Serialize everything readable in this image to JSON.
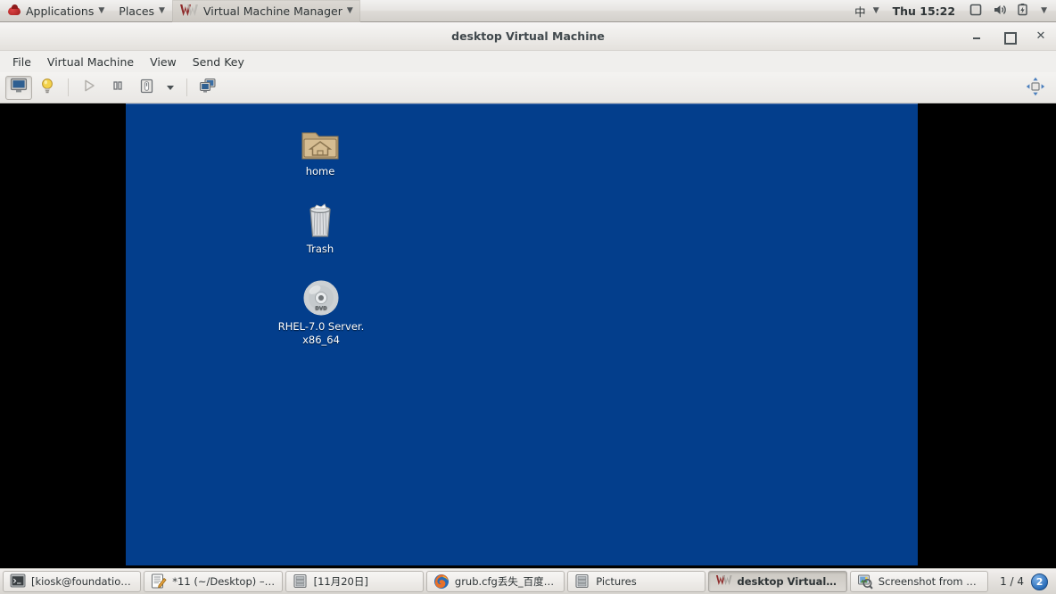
{
  "top_panel": {
    "applications_label": "Applications",
    "places_label": "Places",
    "active_window_label": "Virtual Machine Manager",
    "ime_label": "中",
    "clock": "Thu 15:22",
    "icons": {
      "menu_logo": "redhat-logo-icon",
      "app_icon": "virtual-machine-manager-icon",
      "screen_icon": "display-icon",
      "volume_icon": "volume-icon",
      "battery_icon": "battery-icon",
      "system_caret": "chevron-down-icon"
    }
  },
  "window": {
    "title": "desktop Virtual Machine",
    "controls": {
      "minimize": "–",
      "maximize": "□",
      "close": "✕"
    },
    "menu": [
      {
        "label": "File"
      },
      {
        "label": "Virtual Machine"
      },
      {
        "label": "View"
      },
      {
        "label": "Send Key"
      }
    ],
    "toolbar": [
      {
        "name": "show-console-button",
        "icon": "monitor-icon",
        "state": "pressed"
      },
      {
        "name": "show-details-button",
        "icon": "lightbulb-icon",
        "state": "normal"
      },
      {
        "name": "run-button",
        "icon": "play-icon",
        "state": "disabled"
      },
      {
        "name": "pause-button",
        "icon": "pause-icon",
        "state": "normal"
      },
      {
        "name": "shutdown-button",
        "icon": "power-switch-icon",
        "state": "normal"
      },
      {
        "name": "shutdown-menu-button",
        "icon": "chevron-down-icon",
        "state": "normal"
      },
      {
        "name": "snapshots-button",
        "icon": "clone-screens-icon",
        "state": "normal"
      },
      {
        "name": "fullscreen-button",
        "icon": "fullscreen-arrows-icon",
        "state": "normal"
      }
    ]
  },
  "vm_desktop": {
    "background_color": "#033e8c",
    "icons": [
      {
        "name": "home",
        "label": "home",
        "icon": "home-folder-icon"
      },
      {
        "name": "trash",
        "label": "Trash",
        "icon": "trash-icon"
      },
      {
        "name": "rhel-dvd",
        "label": "RHEL-7.0 Server.\nx86_64",
        "icon": "dvd-disc-icon"
      }
    ]
  },
  "taskbar": {
    "tasks": [
      {
        "label": "[kiosk@foundation3...",
        "icon": "terminal-icon",
        "active": false
      },
      {
        "label": "*11 (~/Desktop) – g...",
        "icon": "text-editor-icon",
        "active": false
      },
      {
        "label": "[11月20日]",
        "icon": "file-manager-icon",
        "active": false
      },
      {
        "label": "grub.cfg丢失_百度搜...",
        "icon": "firefox-icon",
        "active": false
      },
      {
        "label": "Pictures",
        "icon": "file-manager-icon",
        "active": false
      },
      {
        "label": "desktop Virtual Mac...",
        "icon": "virtual-machine-manager-icon",
        "active": true
      },
      {
        "label": "Screenshot from 20...",
        "icon": "screenshot-icon",
        "active": false
      }
    ],
    "workspace_count_label": "1 / 4",
    "workspace_badge": "2"
  }
}
